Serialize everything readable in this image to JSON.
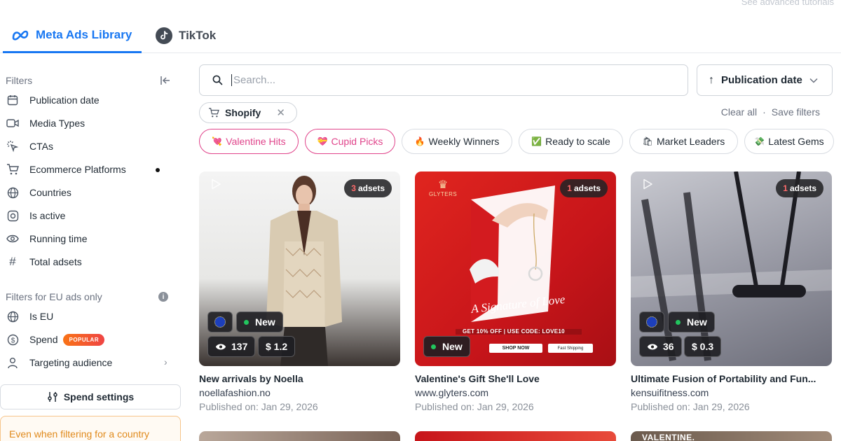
{
  "header": {
    "tutorials_link": "See advanced tutorials"
  },
  "tabs": [
    {
      "label": "Meta Ads Library",
      "active": true
    },
    {
      "label": "TikTok",
      "active": false
    }
  ],
  "sidebar": {
    "filters_title": "Filters",
    "filters": [
      {
        "label": "Publication date",
        "icon": "calendar-icon"
      },
      {
        "label": "Media Types",
        "icon": "video-icon"
      },
      {
        "label": "CTAs",
        "icon": "cursor-click-icon"
      },
      {
        "label": "Ecommerce Platforms",
        "icon": "cart-icon",
        "active_dot": true
      },
      {
        "label": "Countries",
        "icon": "globe-icon"
      },
      {
        "label": "Is active",
        "icon": "toggle-icon"
      },
      {
        "label": "Running time",
        "icon": "eye-icon"
      },
      {
        "label": "Total adsets",
        "icon": "hash-icon"
      }
    ],
    "eu_title": "Filters for EU ads only",
    "eu_filters": [
      {
        "label": "Is EU",
        "icon": "globe-icon"
      },
      {
        "label": "Spend",
        "icon": "dollar-icon",
        "badge": "POPULAR"
      },
      {
        "label": "Targeting audience",
        "icon": "user-icon"
      }
    ],
    "spend_settings": "Spend settings",
    "notice": "Even when filtering for a country"
  },
  "search": {
    "placeholder": "Search...",
    "value": ""
  },
  "sort": {
    "label": "Publication date"
  },
  "active_filter_chip": {
    "label": "Shopify"
  },
  "actions": {
    "clear_all": "Clear all",
    "separator": "·",
    "save_filters": "Save filters"
  },
  "presets": [
    {
      "label": "Valentine Hits",
      "emoji": "💘"
    },
    {
      "label": "Cupid Picks",
      "emoji": "💝"
    },
    {
      "label": "Weekly Winners",
      "emoji": "🔥"
    },
    {
      "label": "Ready to scale",
      "emoji": "✅"
    },
    {
      "label": "Market Leaders",
      "emoji": "🛍"
    },
    {
      "label": "Latest Gems",
      "emoji": "💸"
    }
  ],
  "cards": [
    {
      "adsets_count": "3",
      "adsets_label": "adsets",
      "badge": "New",
      "views": "137",
      "spend": "$ 1.2",
      "title": "New arrivals by Noella",
      "domain": "noellafashion.no",
      "published": "Published on: Jan 29, 2026"
    },
    {
      "adsets_count": "1",
      "adsets_label": "adsets",
      "badge": "New",
      "brand": "GLYTERS",
      "slogan": "A Signature of Love",
      "promo": "GET 10% OFF | USE CODE: LOVE10",
      "shop_now": "SHOP NOW",
      "fast_shipping": "Fast Shipping",
      "title": "Valentine's Gift She'll Love",
      "domain": "www.glyters.com",
      "published": "Published on: Jan 29, 2026"
    },
    {
      "adsets_count": "1",
      "adsets_label": "adsets",
      "badge": "New",
      "views": "36",
      "spend": "$ 0.3",
      "title": "Ultimate Fusion of Portability and Fun...",
      "domain": "kensuifitness.com",
      "published": "Published on: Jan 29, 2026"
    }
  ],
  "row2_partial_text": "VALENTINE."
}
